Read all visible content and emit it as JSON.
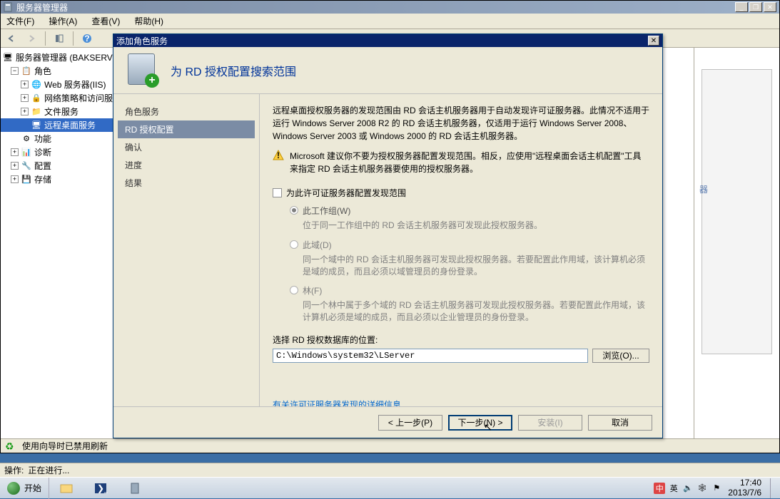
{
  "window": {
    "title": "服务器管理器"
  },
  "menu": {
    "file": "文件(F)",
    "action": "操作(A)",
    "view": "查看(V)",
    "help": "帮助(H)"
  },
  "tree": {
    "root": "服务器管理器 (BAKSERVER",
    "roles": "角色",
    "iis": "Web 服务器(IIS)",
    "nps": "网络策略和访问服",
    "file": "文件服务",
    "rds": "远程桌面服务",
    "features": "功能",
    "diag": "诊断",
    "config": "配置",
    "storage": "存储"
  },
  "right_strip_label": "器",
  "status": {
    "refresh": "使用向导时已禁用刷新"
  },
  "progress": {
    "label": "操作:",
    "text": "正在进行..."
  },
  "dialog": {
    "title": "添加角色服务",
    "header": "为 RD 授权配置搜索范围",
    "nav": {
      "role_services": "角色服务",
      "rd_license": "RD 授权配置",
      "confirm": "确认",
      "progress": "进度",
      "results": "结果"
    },
    "desc1": "远程桌面授权服务器的发现范围由 RD 会话主机服务器用于自动发现许可证服务器。此情况不适用于运行 Windows Server 2008 R2 的 RD 会话主机服务器，仅适用于运行 Windows Server 2008、Windows Server 2003 或 Windows 2000 的 RD 会话主机服务器。",
    "warn": "Microsoft 建议你不要为授权服务器配置发现范围。相反，应使用\"远程桌面会话主机配置\"工具来指定 RD 会话主机服务器要使用的授权服务器。",
    "chk_label": "为此许可证服务器配置发现范围",
    "radio_workgroup": "此工作组(W)",
    "radio_workgroup_desc": "位于同一工作组中的 RD 会话主机服务器可发现此授权服务器。",
    "radio_domain": "此域(D)",
    "radio_domain_desc": "同一个域中的 RD 会话主机服务器可发现此授权服务器。若要配置此作用域，该计算机必须是域的成员，而且必须以域管理员的身份登录。",
    "radio_forest": "林(F)",
    "radio_forest_desc": "同一个林中属于多个域的 RD 会话主机服务器可发现此授权服务器。若要配置此作用域，该计算机必须是域的成员，而且必须以企业管理员的身份登录。",
    "path_label": "选择 RD 授权数据库的位置:",
    "path_value": "C:\\Windows\\system32\\LServer",
    "browse": "浏览(O)...",
    "link": "有关许可证服务器发现的详细信息",
    "btn_prev": "< 上一步(P)",
    "btn_next": "下一步(N) >",
    "btn_install": "安装(I)",
    "btn_cancel": "取消"
  },
  "taskbar": {
    "start": "开始",
    "ime": "中",
    "lang": "英",
    "time": "17:40",
    "date": "2013/7/6"
  }
}
